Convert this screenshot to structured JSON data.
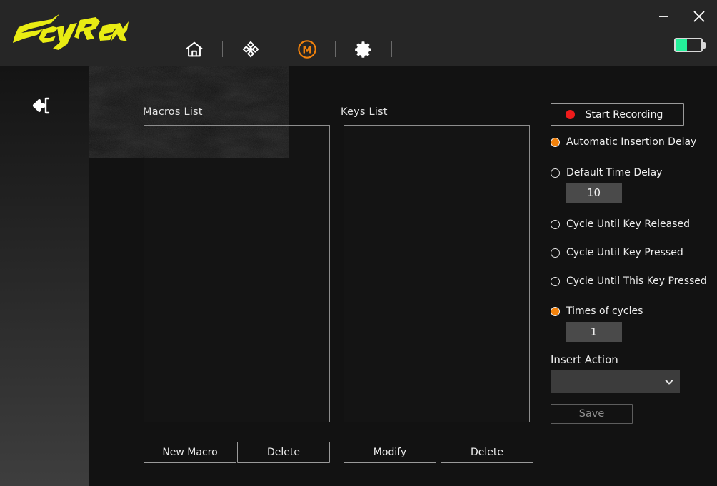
{
  "app": {
    "brand": "ScyRox",
    "accent": "#f2820c",
    "logo_color": "#e9ec13",
    "record_dot_color": "#ef1b1b",
    "battery_color": "#24f09a",
    "battery_level": 45
  },
  "titlebar": {
    "minimize_label": "Minimize",
    "close_label": "Close",
    "minimize_icon": "minimize-icon",
    "close_icon": "close-icon",
    "battery_icon": "battery-icon"
  },
  "nav": {
    "items": [
      {
        "icon": "home-icon",
        "label": "Home",
        "active": false
      },
      {
        "icon": "dpi-crosshair-icon",
        "label": "DPI",
        "active": false
      },
      {
        "icon": "macro-m-icon",
        "label": "Macro",
        "active": true
      },
      {
        "icon": "gear-icon",
        "label": "Settings",
        "active": false
      }
    ]
  },
  "sidebar": {
    "back_icon": "back-exit-icon",
    "back_label": "Back"
  },
  "main": {
    "macros": {
      "label": "Macros List",
      "items": [],
      "buttons": [
        {
          "label": "New Macro",
          "name": "new-macro-button"
        },
        {
          "label": "Delete",
          "name": "delete-macro-button"
        }
      ]
    },
    "keys": {
      "label": "Keys List",
      "items": [],
      "buttons": [
        {
          "label": "Modify",
          "name": "modify-key-button"
        },
        {
          "label": "Delete",
          "name": "delete-key-button"
        }
      ]
    }
  },
  "controls": {
    "record": {
      "label": "Start Recording",
      "icon": "record-dot-icon"
    },
    "options": [
      {
        "label": "Automatic Insertion Delay",
        "selected": true,
        "name": "radio-automatic-insertion-delay"
      },
      {
        "label": "Default Time Delay",
        "selected": false,
        "name": "radio-default-time-delay"
      },
      {
        "label": "Cycle Until Key Released",
        "selected": false,
        "name": "radio-cycle-until-key-released"
      },
      {
        "label": "Cycle Until Key Pressed",
        "selected": false,
        "name": "radio-cycle-until-key-pressed"
      },
      {
        "label": "Cycle Until This Key Pressed",
        "selected": false,
        "name": "radio-cycle-until-this-key-pressed"
      },
      {
        "label": "Times of cycles",
        "selected": true,
        "name": "radio-times-of-cycles"
      }
    ],
    "default_time_delay_value": "10",
    "times_of_cycles_value": "1",
    "insert_action": {
      "label": "Insert Action",
      "value": "",
      "placeholder": "",
      "chevron_icon": "chevron-down-icon"
    },
    "save": {
      "label": "Save",
      "enabled": false
    }
  }
}
